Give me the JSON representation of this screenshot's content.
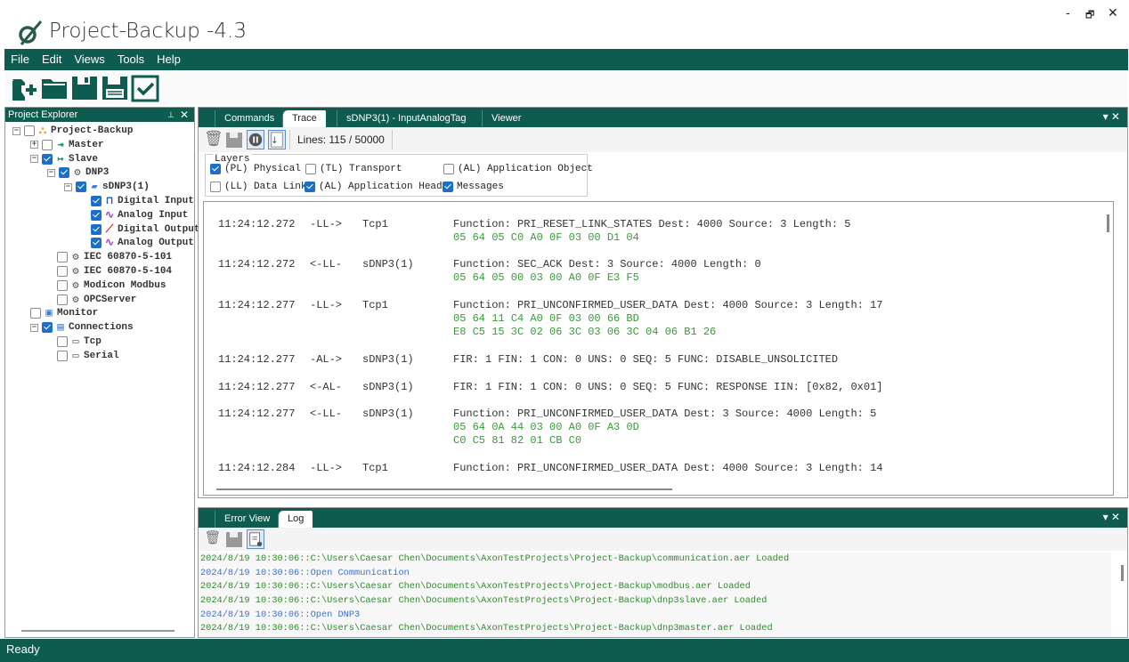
{
  "app": {
    "title": "Project-Backup -4.3",
    "minimize": "-",
    "restore": "🗗",
    "close": "✕"
  },
  "colors": {
    "brand": "#0e5c4f",
    "hex_text": "#3a9a3a",
    "log_info": "#2e8b2e",
    "log_action": "#4070d0",
    "checkbox": "#1d6fc7"
  },
  "menu": [
    "File",
    "Edit",
    "Views",
    "Tools",
    "Help"
  ],
  "toolbar": [
    "new-project-icon",
    "open-folder-icon",
    "save-icon",
    "save-as-icon",
    "check-icon"
  ],
  "explorer": {
    "title": "Project Explorer",
    "pin": "📌",
    "close": "✕",
    "nodes": [
      {
        "label": "Project-Backup",
        "checked": false
      },
      {
        "label": "Master",
        "checked": false
      },
      {
        "label": "Slave",
        "checked": true
      },
      {
        "label": "DNP3",
        "checked": true
      },
      {
        "label": "sDNP3(1)",
        "checked": true
      },
      {
        "label": "Digital Input",
        "checked": true
      },
      {
        "label": "Analog Input",
        "checked": true
      },
      {
        "label": "Digital Output",
        "checked": true
      },
      {
        "label": "Analog Output",
        "checked": true
      },
      {
        "label": "IEC 60870-5-101",
        "checked": false
      },
      {
        "label": "IEC 60870-5-104",
        "checked": false
      },
      {
        "label": "Modicon Modbus",
        "checked": false
      },
      {
        "label": "OPCServer",
        "checked": false
      },
      {
        "label": "Monitor",
        "checked": false
      },
      {
        "label": "Connections",
        "checked": true
      },
      {
        "label": "Tcp",
        "checked": false
      },
      {
        "label": "Serial",
        "checked": false
      }
    ]
  },
  "main": {
    "tabs": [
      "Commands",
      "Trace",
      "sDNP3(1) - InputAnalogTag",
      "Viewer"
    ],
    "active_tab": "Trace",
    "lines": "Lines:  115 / 50000",
    "layers_title": "Layers",
    "layers": [
      {
        "label": "(PL) Physical",
        "checked": true
      },
      {
        "label": "(TL) Transport",
        "checked": false
      },
      {
        "label": "(AL) Application Object",
        "checked": false
      },
      {
        "label": "(LL) Data Link",
        "checked": false
      },
      {
        "label": "(AL) Application Header",
        "checked": true
      },
      {
        "label": "Messages",
        "checked": true
      }
    ],
    "trace": [
      {
        "time": "11:24:12.272",
        "dir": "-LL->",
        "dev": "Tcp1",
        "msg": "Function: PRI_RESET_LINK_STATES Dest: 4000 Source: 3 Length: 5",
        "hex": [
          "05 64 05 C0 A0 0F 03 00 D1 04"
        ]
      },
      {
        "time": "11:24:12.272",
        "dir": "<-LL-",
        "dev": "sDNP3(1)",
        "msg": "Function: SEC_ACK Dest: 3 Source: 4000 Length: 0",
        "hex": [
          "05 64 05 00 03 00 A0 0F E3 F5"
        ]
      },
      {
        "time": "11:24:12.277",
        "dir": "-LL->",
        "dev": "Tcp1",
        "msg": "Function: PRI_UNCONFIRMED_USER_DATA Dest: 4000 Source: 3 Length: 17",
        "hex": [
          "05 64 11 C4 A0 0F 03 00 66 BD",
          "E8 C5 15 3C 02 06 3C 03 06 3C 04 06 B1 26"
        ]
      },
      {
        "time": "11:24:12.277",
        "dir": "-AL->",
        "dev": "sDNP3(1)",
        "msg": "FIR: 1 FIN: 1 CON: 0 UNS: 0 SEQ: 5 FUNC: DISABLE_UNSOLICITED",
        "hex": []
      },
      {
        "time": "11:24:12.277",
        "dir": "<-AL-",
        "dev": "sDNP3(1)",
        "msg": "FIR: 1 FIN: 1 CON: 0 UNS: 0 SEQ: 5 FUNC: RESPONSE IIN: [0x82, 0x01]",
        "hex": []
      },
      {
        "time": "11:24:12.277",
        "dir": "<-LL-",
        "dev": "sDNP3(1)",
        "msg": "Function: PRI_UNCONFIRMED_USER_DATA Dest: 3 Source: 4000 Length: 5",
        "hex": [
          "05 64 0A 44 03 00 A0 0F A3 0D",
          "C0 C5 81 82 01 CB C0"
        ]
      },
      {
        "time": "11:24:12.284",
        "dir": "-LL->",
        "dev": "Tcp1",
        "msg": "Function: PRI_UNCONFIRMED_USER_DATA Dest: 4000 Source: 3 Length: 14",
        "hex": []
      }
    ]
  },
  "bottom": {
    "tabs": [
      "Error View",
      "Log"
    ],
    "active_tab": "Log",
    "log": [
      {
        "text": "2024/8/19 10:30:06::C:\\Users\\Caesar Chen\\Documents\\AxonTestProjects\\Project-Backup\\communication.aer Loaded",
        "kind": "g"
      },
      {
        "text": "2024/8/19 10:30:06::Open Communication",
        "kind": "b"
      },
      {
        "text": "2024/8/19 10:30:06::C:\\Users\\Caesar Chen\\Documents\\AxonTestProjects\\Project-Backup\\modbus.aer Loaded",
        "kind": "g"
      },
      {
        "text": "2024/8/19 10:30:06::C:\\Users\\Caesar Chen\\Documents\\AxonTestProjects\\Project-Backup\\dnp3slave.aer Loaded",
        "kind": "g"
      },
      {
        "text": "2024/8/19 10:30:06::Open DNP3",
        "kind": "b"
      },
      {
        "text": "2024/8/19 10:30:06::C:\\Users\\Caesar Chen\\Documents\\AxonTestProjects\\Project-Backup\\dnp3master.aer Loaded",
        "kind": "g"
      }
    ]
  },
  "status": "Ready"
}
